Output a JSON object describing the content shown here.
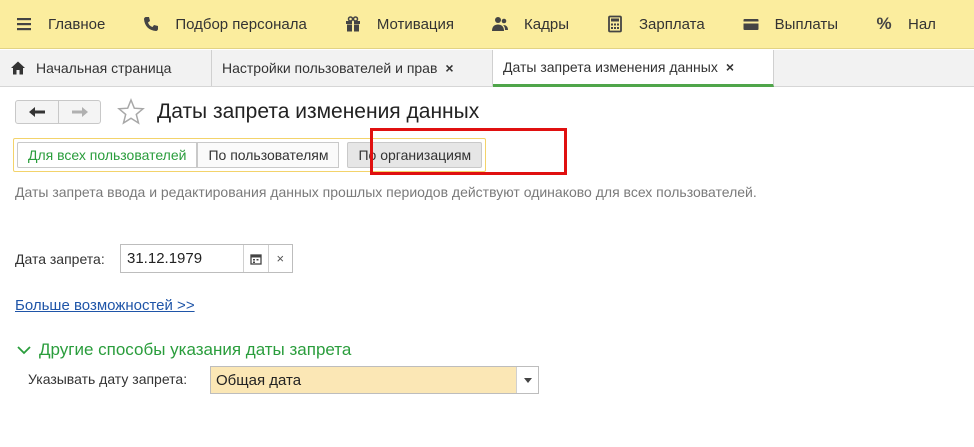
{
  "menu": [
    {
      "label": "Главное",
      "icon": "hamburger-icon"
    },
    {
      "label": "Подбор персонала",
      "icon": "phone-icon"
    },
    {
      "label": "Мотивация",
      "icon": "gift-icon"
    },
    {
      "label": "Кадры",
      "icon": "people-icon"
    },
    {
      "label": "Зарплата",
      "icon": "calculator-icon"
    },
    {
      "label": "Выплаты",
      "icon": "wallet-icon"
    },
    {
      "label": "Нал",
      "icon": "percent-icon"
    }
  ],
  "tabs": [
    {
      "label": "Начальная страница",
      "icon": "home-icon"
    },
    {
      "label": "Настройки пользователей и прав",
      "close": "×"
    },
    {
      "label": "Даты запрета изменения данных",
      "close": "×"
    }
  ],
  "header": {
    "title": "Даты запрета изменения данных"
  },
  "modes": {
    "all_users": "Для всех пользователей",
    "by_users": "По пользователям",
    "by_orgs": "По организациям"
  },
  "info_text": "Даты запрета ввода и редактирования данных прошлых периодов действуют одинаково для всех пользователей.",
  "date": {
    "label": "Дата запрета:",
    "value": "31.12.1979",
    "clear": "×"
  },
  "more_link": "Больше возможностей >>",
  "group": {
    "title": "Другие способы указания даты запрета",
    "spec_label": "Указывать дату запрета:",
    "spec_value": "Общая дата"
  },
  "colors": {
    "menu_bg": "#fbed9e",
    "accent_green": "#2a9d3c",
    "highlight_red": "#e01010",
    "link_blue": "#1f55a8",
    "select_bg": "#fbe7b5"
  }
}
